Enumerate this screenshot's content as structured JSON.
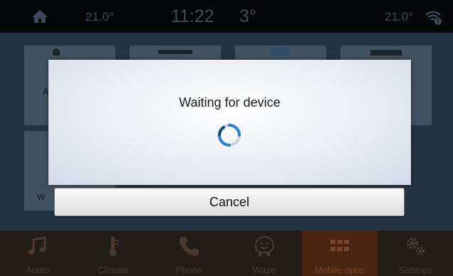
{
  "status_bar": {
    "home_icon": "home-icon",
    "driver_temp": "21.0°",
    "clock": "11:22",
    "outside_temp": "3°",
    "passenger_temp": "21.0°",
    "signal_icon": "wifi-info-icon"
  },
  "app_grid": {
    "tiles": [
      {
        "label": "A"
      },
      {
        "label": ""
      },
      {
        "label": ""
      },
      {
        "label": ""
      },
      {
        "label": "W"
      }
    ]
  },
  "dialog": {
    "title": "Waiting for device",
    "spinner_icon": "loading-spinner-icon",
    "cancel_label": "Cancel"
  },
  "bottom_nav": {
    "items": [
      {
        "label": "Audio",
        "icon": "music-note-icon",
        "active": false
      },
      {
        "label": "Climate",
        "icon": "thermometer-icon",
        "active": false
      },
      {
        "label": "Phone",
        "icon": "phone-icon",
        "active": false
      },
      {
        "label": "Waze",
        "icon": "waze-icon",
        "active": false
      },
      {
        "label": "Mobile apps",
        "icon": "apps-grid-icon",
        "active": true
      },
      {
        "label": "Settings",
        "icon": "gears-icon",
        "active": false
      }
    ]
  },
  "colors": {
    "status_text": "#3d4a57",
    "nav_active": "#4a2411",
    "spinner_blue": "#2b7fd4"
  }
}
